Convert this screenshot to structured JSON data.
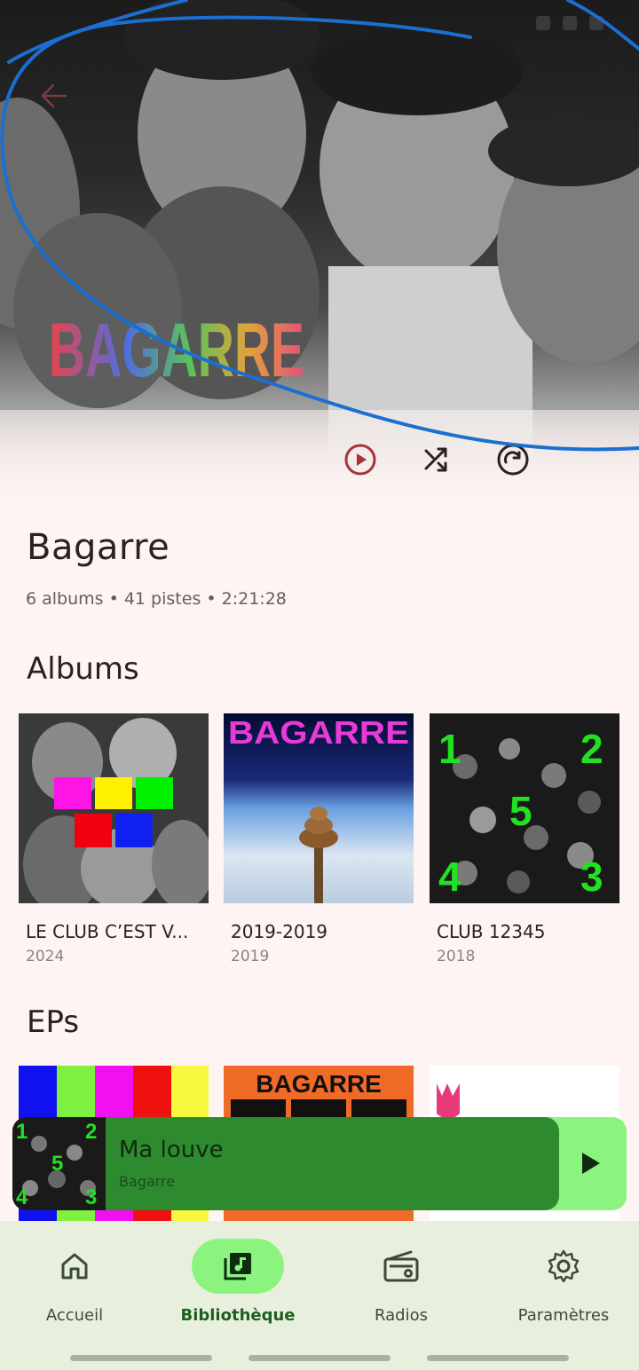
{
  "artist": {
    "logo_text": "BAGARRE",
    "name": "Bagarre",
    "meta": "6 albums • 41 pistes • 2:21:28"
  },
  "sections": {
    "albums_title": "Albums",
    "eps_title": "EPs"
  },
  "albums": [
    {
      "title": "LE CLUB C’EST V...",
      "year": "2024"
    },
    {
      "title": "2019-2019",
      "year": "2019"
    },
    {
      "title": "CLUB 12345",
      "year": "2018"
    }
  ],
  "album_cover_text": {
    "cover2_logo": "BAGARRE",
    "cover3_numbers": [
      "1",
      "2",
      "5",
      "4",
      "3"
    ]
  },
  "ep_cover_text": {
    "ep2_logo": "BAGARRE"
  },
  "mini_player": {
    "title": "Ma louve",
    "artist": "Bagarre",
    "cover_numbers": [
      "1",
      "2",
      "5",
      "4",
      "3"
    ],
    "progress_fraction": 0.89
  },
  "nav": [
    {
      "label": "Accueil",
      "icon": "home-icon",
      "active": false
    },
    {
      "label": "Bibliothèque",
      "icon": "library-music-icon",
      "active": true
    },
    {
      "label": "Radios",
      "icon": "radio-icon",
      "active": false
    },
    {
      "label": "Paramètres",
      "icon": "gear-icon",
      "active": false
    }
  ],
  "colors": {
    "background": "#fdf4f3",
    "accent_green": "#8af47f",
    "player_dark_green": "#2e8a2f",
    "nav_background": "#e8f0dd",
    "play_icon_red": "#a8323a",
    "annotation_blue": "#1a6fd1"
  }
}
